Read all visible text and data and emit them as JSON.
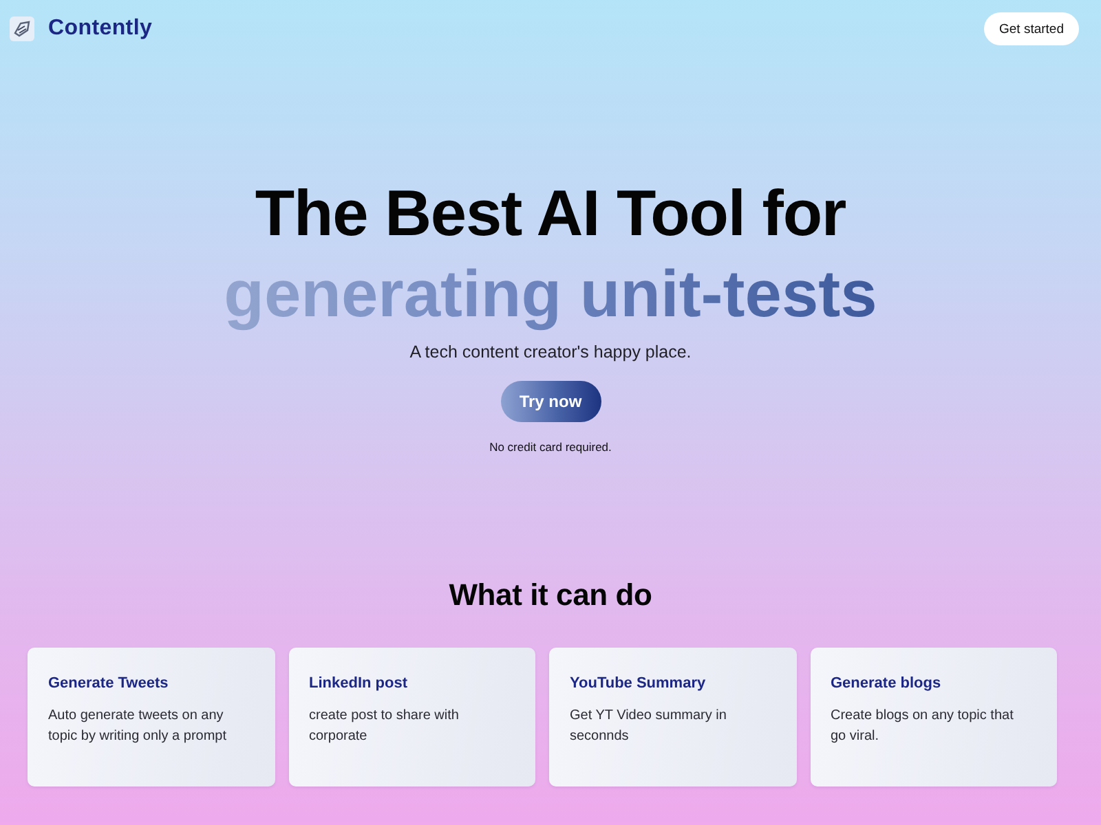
{
  "header": {
    "brand": "Contently",
    "cta": "Get started"
  },
  "hero": {
    "title": "The Best AI Tool for",
    "highlight": "generating unit-tests",
    "subtitle": "A tech content creator's happy place.",
    "button": "Try now",
    "note": "No credit card required."
  },
  "features": {
    "heading": "What it can do",
    "cards": [
      {
        "title": "Generate Tweets",
        "description": "Auto generate tweets on any topic by writing only a prompt"
      },
      {
        "title": "LinkedIn post",
        "description": "create post to share with corporate"
      },
      {
        "title": "YouTube Summary",
        "description": "Get YT Video summary in seconnds"
      },
      {
        "title": "Generate blogs",
        "description": "Create blogs on any topic that go viral."
      }
    ]
  }
}
